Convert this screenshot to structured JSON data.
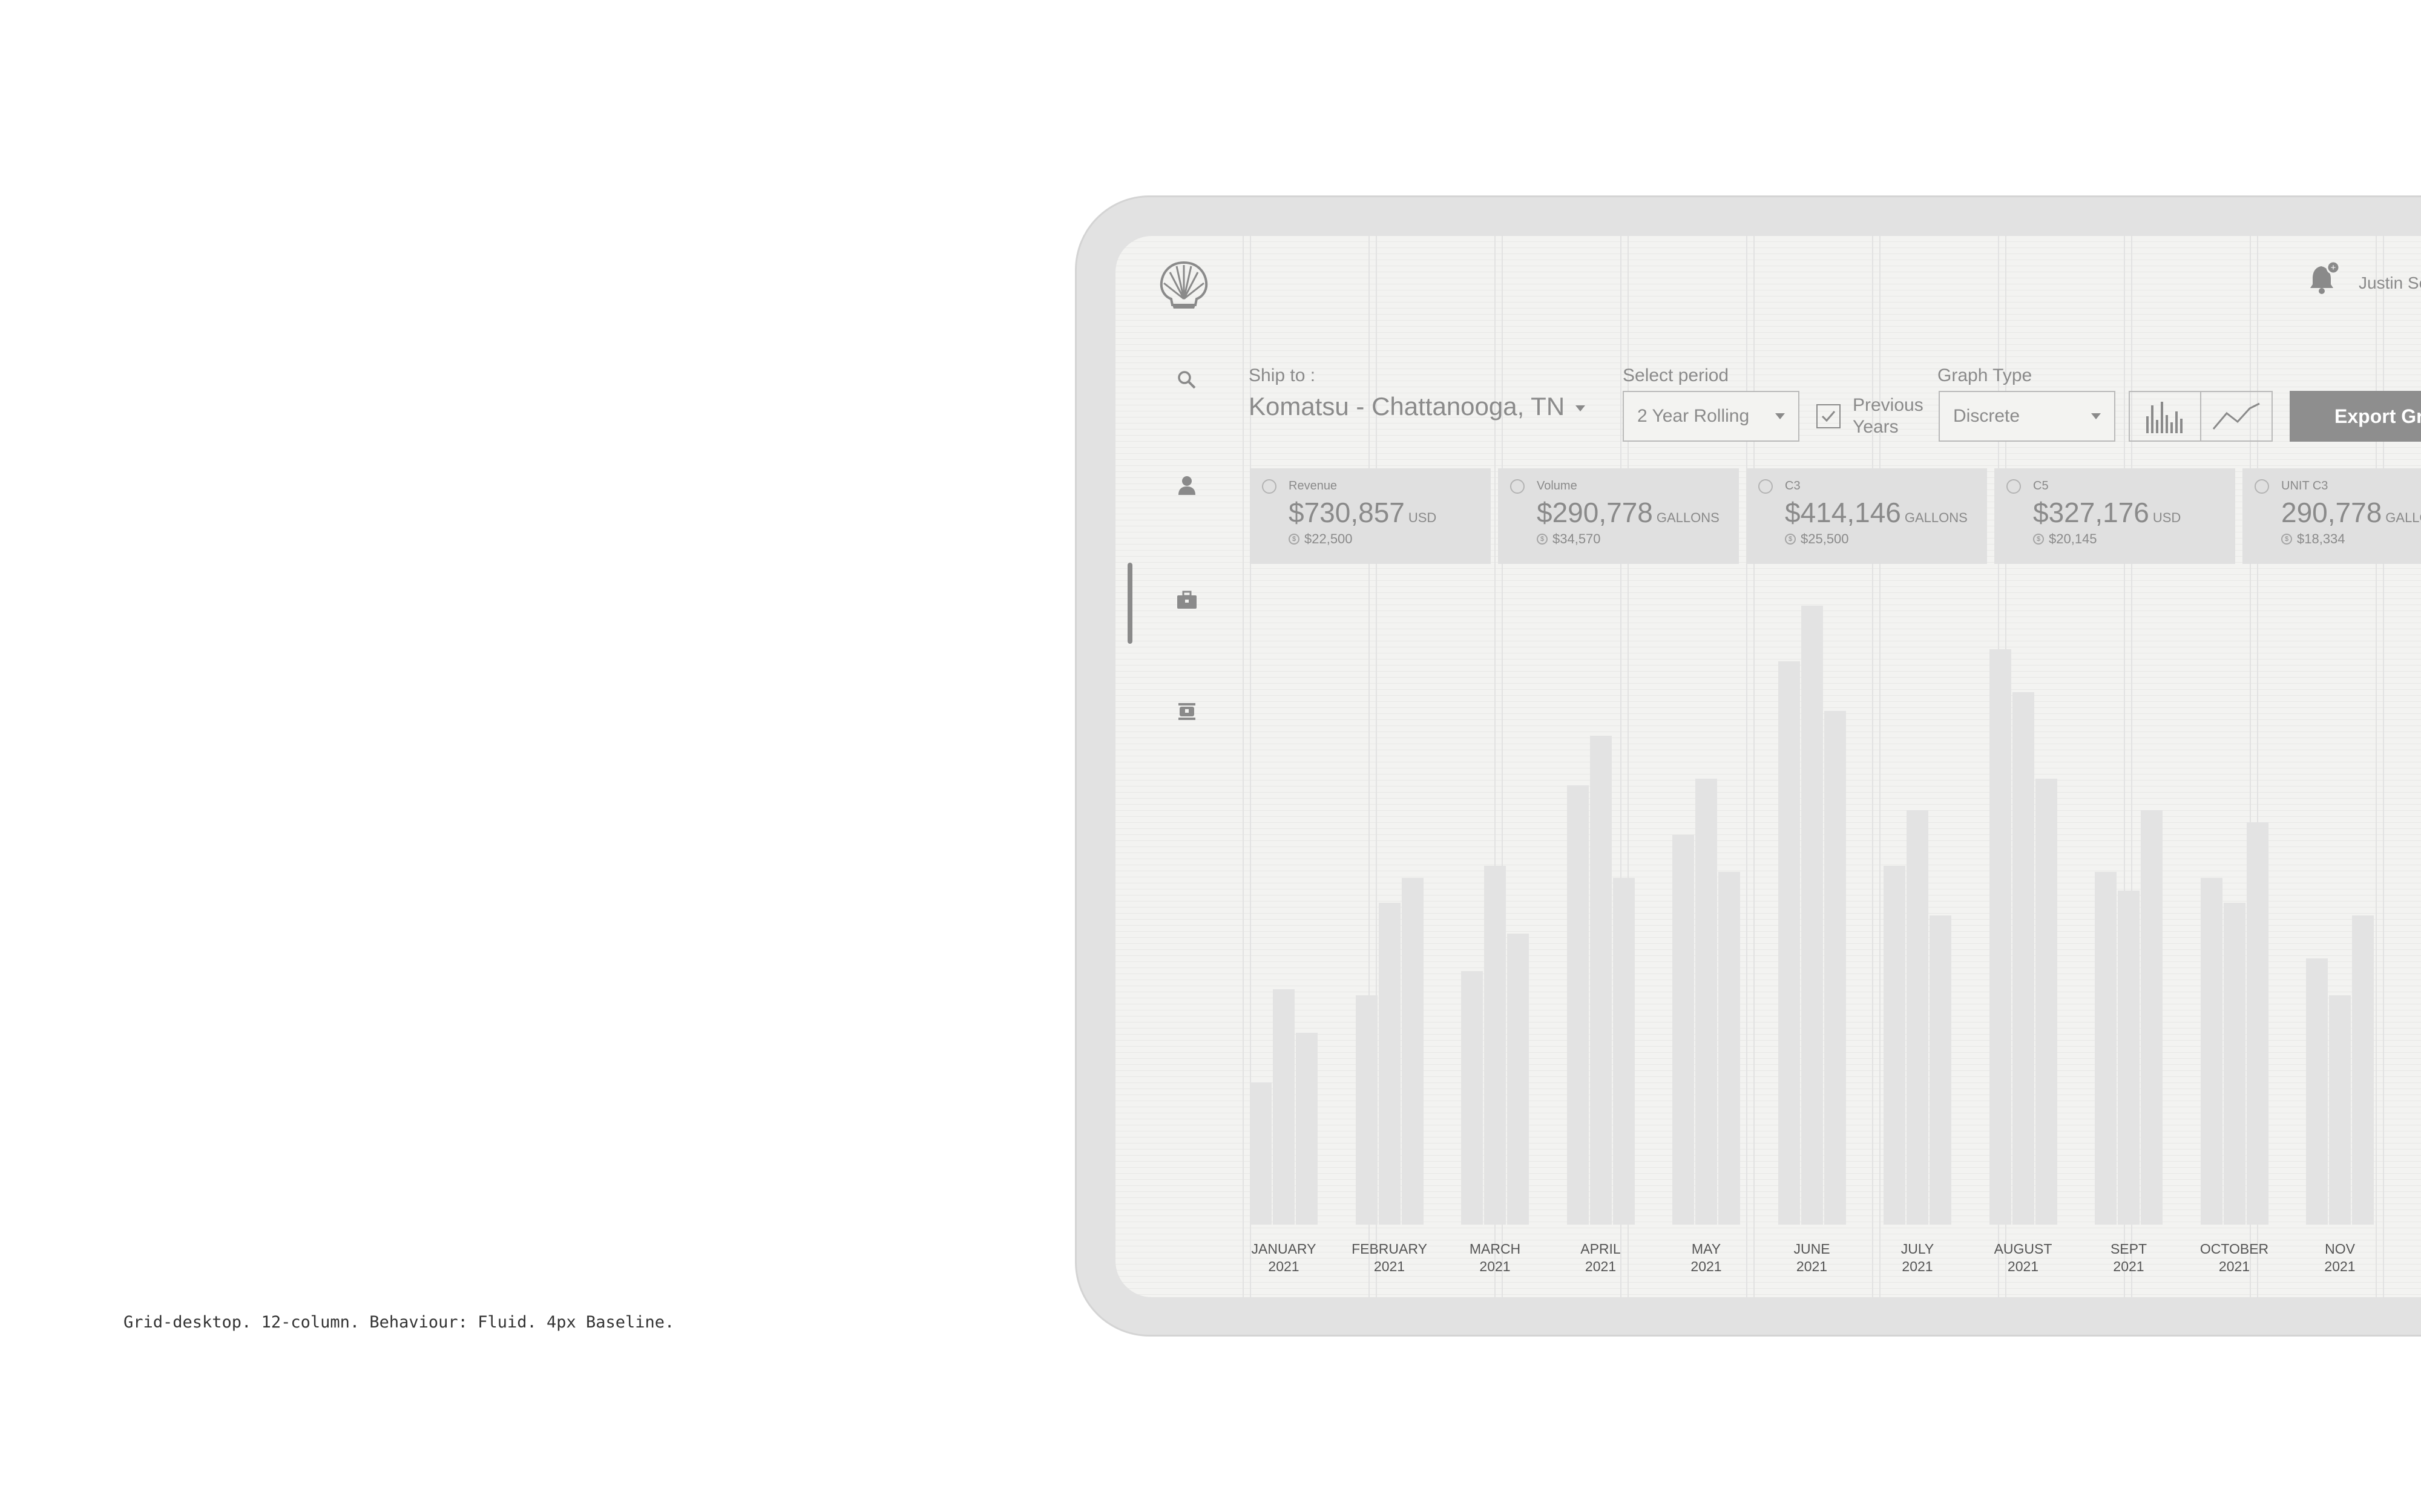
{
  "caption": "Grid-desktop. 12-column. Behaviour: Fluid. 4px Baseline.",
  "app": {
    "logo": "shell-logo",
    "nav": [
      {
        "icon": "search-icon",
        "active": false
      },
      {
        "icon": "user-icon",
        "active": false
      },
      {
        "icon": "briefcase-icon",
        "active": true
      },
      {
        "icon": "tanker-icon",
        "active": false
      }
    ],
    "header": {
      "notifications_icon": "bell-icon",
      "notification_badge": "+",
      "user_name": "Justin Se"
    }
  },
  "filters": {
    "ship_to_label": "Ship to :",
    "ship_to_value": "Komatsu - Chattanooga, TN",
    "period_label": "Select period",
    "period_value": "2 Year Rolling",
    "previous_years_label_1": "Previous",
    "previous_years_label_2": "Years",
    "previous_years_checked": true,
    "graph_type_label": "Graph Type",
    "graph_type_value": "Discrete",
    "graph_view_options": [
      "bar-chart-icon",
      "line-chart-icon"
    ],
    "export_label": "Export Gra"
  },
  "metrics": [
    {
      "label": "Revenue",
      "value": "$730,857",
      "unit": "USD",
      "sub": "$22,500"
    },
    {
      "label": "Volume",
      "value": "$290,778",
      "unit": "GALLONS",
      "sub": "$34,570"
    },
    {
      "label": "C3",
      "value": "$414,146",
      "unit": "GALLONS",
      "sub": "$25,500"
    },
    {
      "label": "C5",
      "value": "$327,176",
      "unit": "USD",
      "sub": "$20,145"
    },
    {
      "label": "UNIT C3",
      "value": "290,778",
      "unit": "GALLO",
      "sub": "$18,334"
    }
  ],
  "colors": {
    "bar": "#e3e3e3",
    "card": "#e0e0e0",
    "button": "#8e8e8e",
    "text": "#8a8a8a"
  },
  "chart_data": {
    "type": "bar",
    "categories": [
      "JANUARY 2021",
      "FEBRUARY 2021",
      "MARCH 2021",
      "APRIL 2021",
      "MAY 2021",
      "JUNE 2021",
      "JULY 2021",
      "AUGUST 2021",
      "SEPT 2021",
      "OCTOBER 2021",
      "NOV 2021"
    ],
    "month_lines": [
      [
        "JANUARY",
        "2021"
      ],
      [
        "FEBRUARY",
        "2021"
      ],
      [
        "MARCH",
        "2021"
      ],
      [
        "APRIL",
        "2021"
      ],
      [
        "MAY",
        "2021"
      ],
      [
        "JUNE",
        "2021"
      ],
      [
        "JULY",
        "2021"
      ],
      [
        "AUGUST",
        "2021"
      ],
      [
        "SEPT",
        "2021"
      ],
      [
        "OCTOBER",
        "2021"
      ],
      [
        "NOV",
        "2021"
      ]
    ],
    "series": [
      {
        "values": [
          23,
          37,
          41,
          71,
          63,
          91,
          58,
          93,
          57,
          56,
          43
        ]
      },
      {
        "values": [
          38,
          52,
          58,
          79,
          72,
          100,
          67,
          86,
          54,
          52,
          37
        ]
      },
      {
        "values": [
          31,
          56,
          47,
          56,
          57,
          83,
          50,
          72,
          67,
          65,
          50
        ]
      }
    ],
    "ylim": [
      0,
      100
    ],
    "grid": false,
    "legend": "none"
  }
}
